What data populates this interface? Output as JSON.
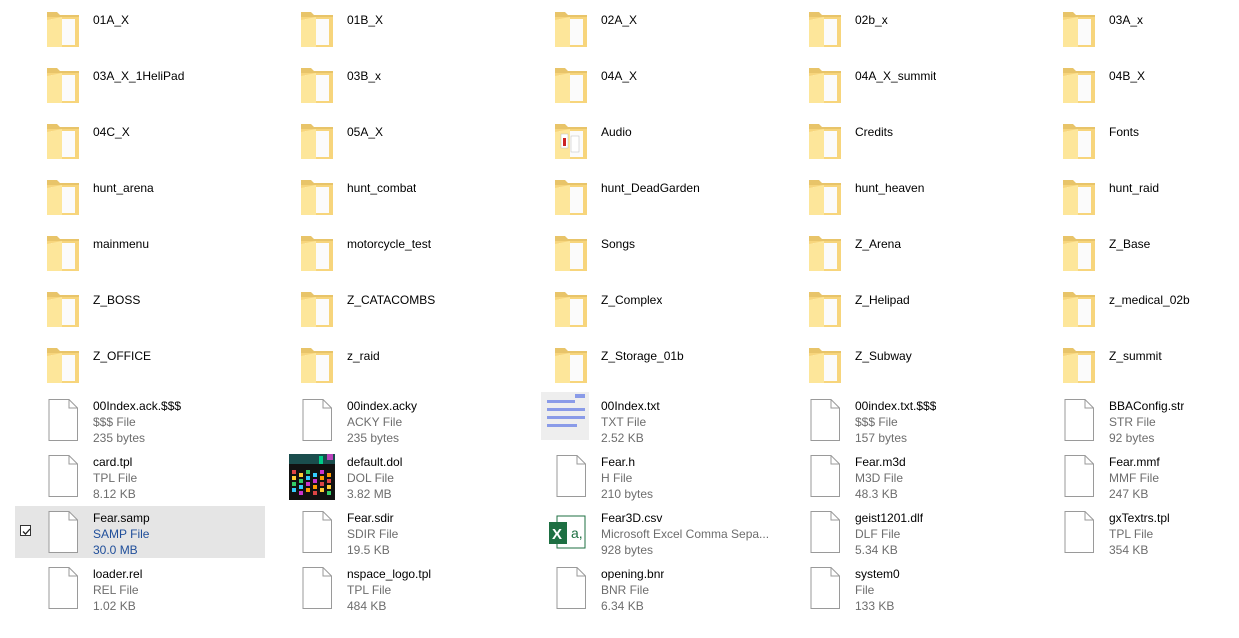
{
  "items": [
    {
      "name": "01A_X",
      "kind": "folder"
    },
    {
      "name": "01B_X",
      "kind": "folder"
    },
    {
      "name": "02A_X",
      "kind": "folder"
    },
    {
      "name": "02b_x",
      "kind": "folder"
    },
    {
      "name": "03A_x",
      "kind": "folder"
    },
    {
      "name": "03A_X_1HeliPad",
      "kind": "folder"
    },
    {
      "name": "03B_x",
      "kind": "folder"
    },
    {
      "name": "04A_X",
      "kind": "folder"
    },
    {
      "name": "04A_X_summit",
      "kind": "folder"
    },
    {
      "name": "04B_X",
      "kind": "folder"
    },
    {
      "name": "04C_X",
      "kind": "folder"
    },
    {
      "name": "05A_X",
      "kind": "folder"
    },
    {
      "name": "Audio",
      "kind": "folder-audio"
    },
    {
      "name": "Credits",
      "kind": "folder"
    },
    {
      "name": "Fonts",
      "kind": "folder"
    },
    {
      "name": "hunt_arena",
      "kind": "folder"
    },
    {
      "name": "hunt_combat",
      "kind": "folder"
    },
    {
      "name": "hunt_DeadGarden",
      "kind": "folder"
    },
    {
      "name": "hunt_heaven",
      "kind": "folder"
    },
    {
      "name": "hunt_raid",
      "kind": "folder"
    },
    {
      "name": "mainmenu",
      "kind": "folder"
    },
    {
      "name": "motorcycle_test",
      "kind": "folder"
    },
    {
      "name": "Songs",
      "kind": "folder"
    },
    {
      "name": "Z_Arena",
      "kind": "folder"
    },
    {
      "name": "Z_Base",
      "kind": "folder"
    },
    {
      "name": "Z_BOSS",
      "kind": "folder"
    },
    {
      "name": "Z_CATACOMBS",
      "kind": "folder"
    },
    {
      "name": "Z_Complex",
      "kind": "folder"
    },
    {
      "name": "Z_Helipad",
      "kind": "folder"
    },
    {
      "name": "z_medical_02b",
      "kind": "folder"
    },
    {
      "name": "Z_OFFICE",
      "kind": "folder"
    },
    {
      "name": "z_raid",
      "kind": "folder"
    },
    {
      "name": "Z_Storage_01b",
      "kind": "folder"
    },
    {
      "name": "Z_Subway",
      "kind": "folder"
    },
    {
      "name": "Z_summit",
      "kind": "folder"
    },
    {
      "name": "00Index.ack.$$$",
      "type": "$$$ File",
      "size": "235 bytes",
      "kind": "file"
    },
    {
      "name": "00index.acky",
      "type": "ACKY File",
      "size": "235 bytes",
      "kind": "file"
    },
    {
      "name": "00Index.txt",
      "type": "TXT File",
      "size": "2.52 KB",
      "kind": "txt"
    },
    {
      "name": "00index.txt.$$$",
      "type": "$$$ File",
      "size": "157 bytes",
      "kind": "file"
    },
    {
      "name": "BBAConfig.str",
      "type": "STR File",
      "size": "92 bytes",
      "kind": "file"
    },
    {
      "name": "card.tpl",
      "type": "TPL File",
      "size": "8.12 KB",
      "kind": "file"
    },
    {
      "name": "default.dol",
      "type": "DOL File",
      "size": "3.82 MB",
      "kind": "dol"
    },
    {
      "name": "Fear.h",
      "type": "H File",
      "size": "210 bytes",
      "kind": "file"
    },
    {
      "name": "Fear.m3d",
      "type": "M3D File",
      "size": "48.3 KB",
      "kind": "file"
    },
    {
      "name": "Fear.mmf",
      "type": "MMF File",
      "size": "247 KB",
      "kind": "file"
    },
    {
      "name": "Fear.samp",
      "type": "SAMP File",
      "size": "30.0 MB",
      "kind": "file",
      "selected": true
    },
    {
      "name": "Fear.sdir",
      "type": "SDIR File",
      "size": "19.5 KB",
      "kind": "file"
    },
    {
      "name": "Fear3D.csv",
      "type": "Microsoft Excel Comma Sepa...",
      "size": "928 bytes",
      "kind": "excel"
    },
    {
      "name": "geist1201.dlf",
      "type": "DLF File",
      "size": "5.34 KB",
      "kind": "file"
    },
    {
      "name": "gxTextrs.tpl",
      "type": "TPL File",
      "size": "354 KB",
      "kind": "file"
    },
    {
      "name": "loader.rel",
      "type": "REL File",
      "size": "1.02 KB",
      "kind": "file"
    },
    {
      "name": "nspace_logo.tpl",
      "type": "TPL File",
      "size": "484 KB",
      "kind": "file"
    },
    {
      "name": "opening.bnr",
      "type": "BNR File",
      "size": "6.34 KB",
      "kind": "file"
    },
    {
      "name": "system0",
      "type": "File",
      "size": "133 KB",
      "kind": "file"
    }
  ]
}
